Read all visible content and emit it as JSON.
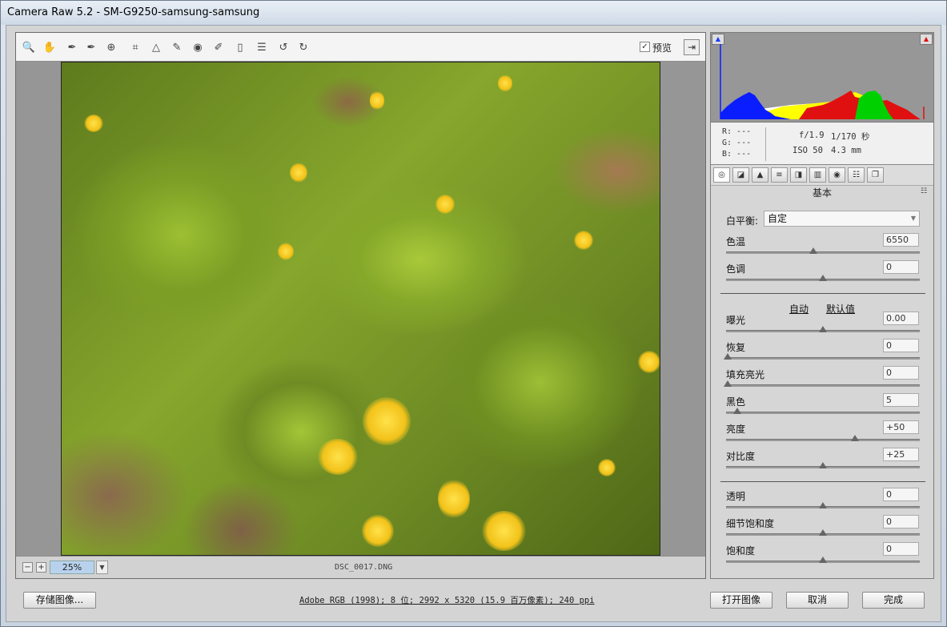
{
  "window": {
    "title": "Camera Raw 5.2 -  SM-G9250-samsung-samsung"
  },
  "toolbar": {
    "tools": [
      {
        "name": "zoom-tool",
        "glyph": "🔍"
      },
      {
        "name": "hand-tool",
        "glyph": "✋"
      },
      {
        "name": "white-balance-tool",
        "glyph": "✒"
      },
      {
        "name": "color-sampler-tool",
        "glyph": "✒"
      },
      {
        "name": "targeted-adjustment-tool",
        "glyph": "⊕"
      },
      {
        "name": "crop-tool",
        "glyph": "⌗"
      },
      {
        "name": "straighten-tool",
        "glyph": "△"
      },
      {
        "name": "spot-removal-tool",
        "glyph": "✎"
      },
      {
        "name": "red-eye-tool",
        "glyph": "◉"
      },
      {
        "name": "adjustment-brush-tool",
        "glyph": "✐"
      },
      {
        "name": "graduated-filter-tool",
        "glyph": "▯"
      },
      {
        "name": "preferences-tool",
        "glyph": "☰"
      },
      {
        "name": "rotate-ccw-tool",
        "glyph": "↺"
      },
      {
        "name": "rotate-cw-tool",
        "glyph": "↻"
      }
    ],
    "preview_label": "预览",
    "preview_checked": "✓",
    "fullscreen_glyph": "⇥"
  },
  "status": {
    "zoom_minus": "−",
    "zoom_plus": "+",
    "zoom_value": "25%",
    "zoom_dropdown": "▼",
    "filename": "DSC_0017.DNG"
  },
  "histogram": {
    "shadow_clip_glyph": "▲",
    "highlight_clip_glyph": "▲",
    "colors": {
      "blue": "#0a1dff",
      "yellow": "#ffff00",
      "red": "#e01010",
      "green": "#00d000",
      "white": "#ffffff"
    }
  },
  "info": {
    "r": "R:  ---",
    "g": "G:  ---",
    "b": "B:  ---",
    "aperture": "f/1.9",
    "shutter": "1/170 秒",
    "iso": "ISO 50",
    "focal": "4.3 mm"
  },
  "panel": {
    "tab_glyphs": [
      "◎",
      "◪",
      "▲",
      "≡",
      "◨",
      "▥",
      "◉",
      "☷",
      "❐"
    ],
    "title": "基本",
    "menu_glyph": "☷"
  },
  "basic": {
    "white_balance_label": "白平衡:",
    "white_balance_value": "自定",
    "white_balance_arrow": "▼",
    "auto_label": "自动",
    "default_label": "默认值",
    "sliders": [
      {
        "id": "temperature",
        "label": "色温",
        "value": "6550",
        "pos": 0.45
      },
      {
        "id": "tint",
        "label": "色调",
        "value": "0",
        "pos": 0.5
      },
      {
        "id": "exposure",
        "label": "曝光",
        "value": "0.00",
        "pos": 0.5
      },
      {
        "id": "recovery",
        "label": "恢复",
        "value": "0",
        "pos": 0.0
      },
      {
        "id": "fill-light",
        "label": "填充亮光",
        "value": "0",
        "pos": 0.0
      },
      {
        "id": "blacks",
        "label": "黑色",
        "value": "5",
        "pos": 0.05
      },
      {
        "id": "brightness",
        "label": "亮度",
        "value": "+50",
        "pos": 0.667
      },
      {
        "id": "contrast",
        "label": "对比度",
        "value": "+25",
        "pos": 0.5
      },
      {
        "id": "clarity",
        "label": "透明",
        "value": "0",
        "pos": 0.5
      },
      {
        "id": "vibrance",
        "label": "细节饱和度",
        "value": "0",
        "pos": 0.5
      },
      {
        "id": "saturation",
        "label": "饱和度",
        "value": "0",
        "pos": 0.5
      }
    ]
  },
  "bottom": {
    "save_label": "存储图像...",
    "workflow_text": "Adobe RGB (1998); 8 位; 2992 x 5320 (15.9 百万像素); 240 ppi",
    "open_label": "打开图像",
    "cancel_label": "取消",
    "done_label": "完成"
  }
}
